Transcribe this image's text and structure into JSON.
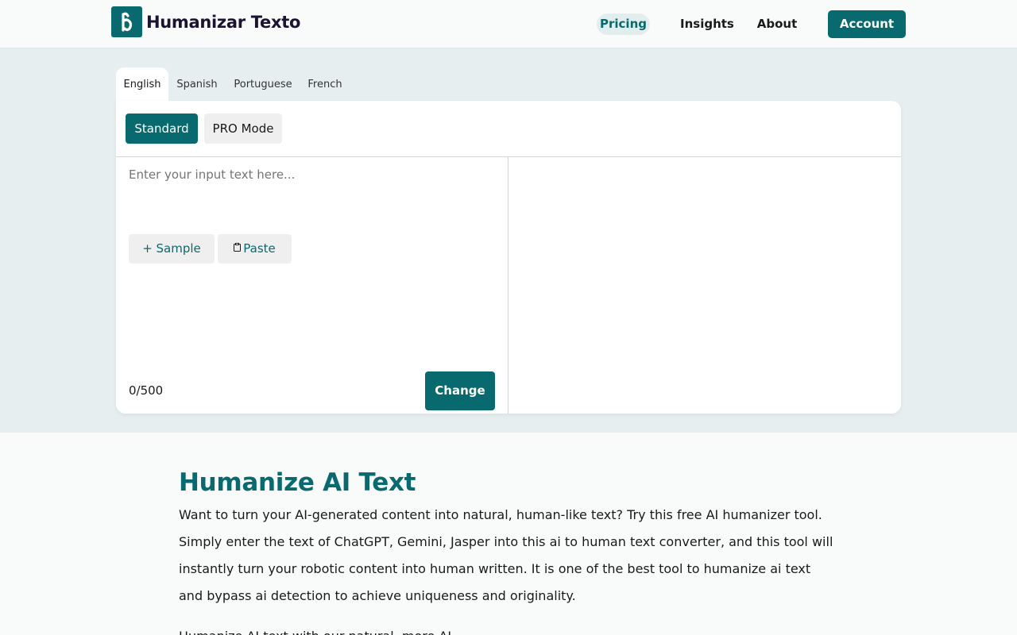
{
  "brand": {
    "name": "Humanizar Texto",
    "logo_icon": "stylized-h-logo",
    "color": "#086a6e"
  },
  "nav": {
    "pricing": "Pricing",
    "insights": "Insights",
    "about": "About",
    "account": "Account"
  },
  "languages": [
    "English",
    "Spanish",
    "Portuguese",
    "French"
  ],
  "active_language": "English",
  "modes": {
    "standard": "Standard",
    "pro": "PRO Mode",
    "active": "Standard"
  },
  "editor": {
    "placeholder": "Enter your input text here...",
    "value": "",
    "sample_label": "+ Sample",
    "paste_label": "Paste",
    "paste_icon": "clipboard-icon",
    "counter": "0/500",
    "change_label": "Change"
  },
  "content": {
    "heading": "Humanize AI Text",
    "paragraph": "Want to turn your AI-generated content into natural, human-like text? Try this free AI humanizer tool. Simply enter the text of ChatGPT, Gemini, Jasper into this ai to human text converter, and this tool will instantly turn your robotic content into human written. It is one of the best tool to humanize ai text and bypass ai detection to achieve uniqueness and originality.",
    "next_line": "Humanize AI text with our natural, more AI humanizer"
  }
}
